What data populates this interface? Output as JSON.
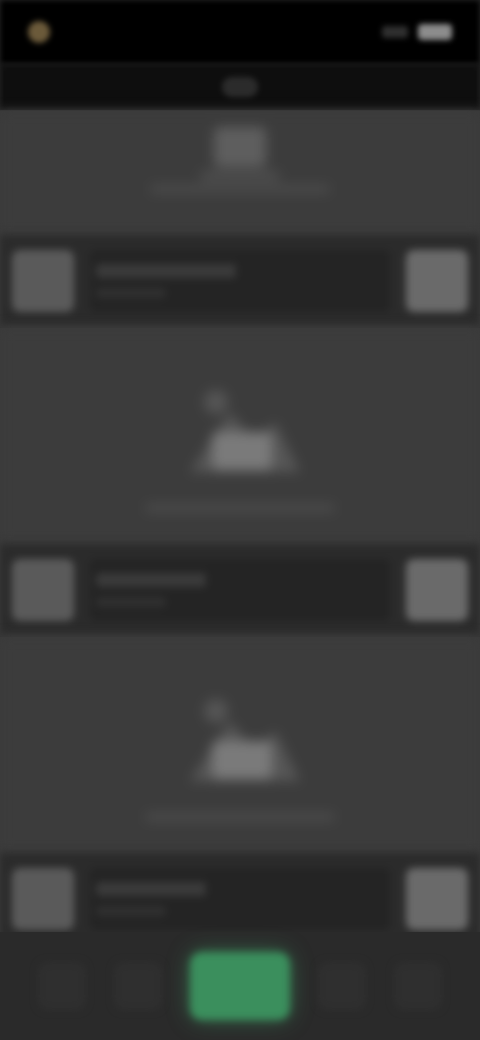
{
  "status_bar": {
    "time": "",
    "icons": [
      "app-indicator-icon",
      "signal-icon",
      "battery-icon"
    ]
  },
  "header": {
    "icon": "app-logo-icon"
  },
  "feed": {
    "cards": [
      {
        "title": "",
        "subtitle": "",
        "thumbnail_icon": "thumbnail-icon",
        "action_icon": "action-icon"
      },
      {
        "title": "",
        "subtitle": "",
        "thumbnail_icon": "thumbnail-icon",
        "action_icon": "action-icon"
      },
      {
        "title": "",
        "subtitle": "",
        "thumbnail_icon": "thumbnail-icon",
        "action_icon": "action-icon"
      }
    ]
  },
  "bottom_nav": {
    "items": [
      {
        "icon": "home-icon",
        "active": false
      },
      {
        "icon": "search-icon",
        "active": false
      },
      {
        "icon": "create-icon",
        "active": true
      },
      {
        "icon": "library-icon",
        "active": false
      },
      {
        "icon": "profile-icon",
        "active": false
      }
    ],
    "active_color": "#3b8f5d"
  }
}
